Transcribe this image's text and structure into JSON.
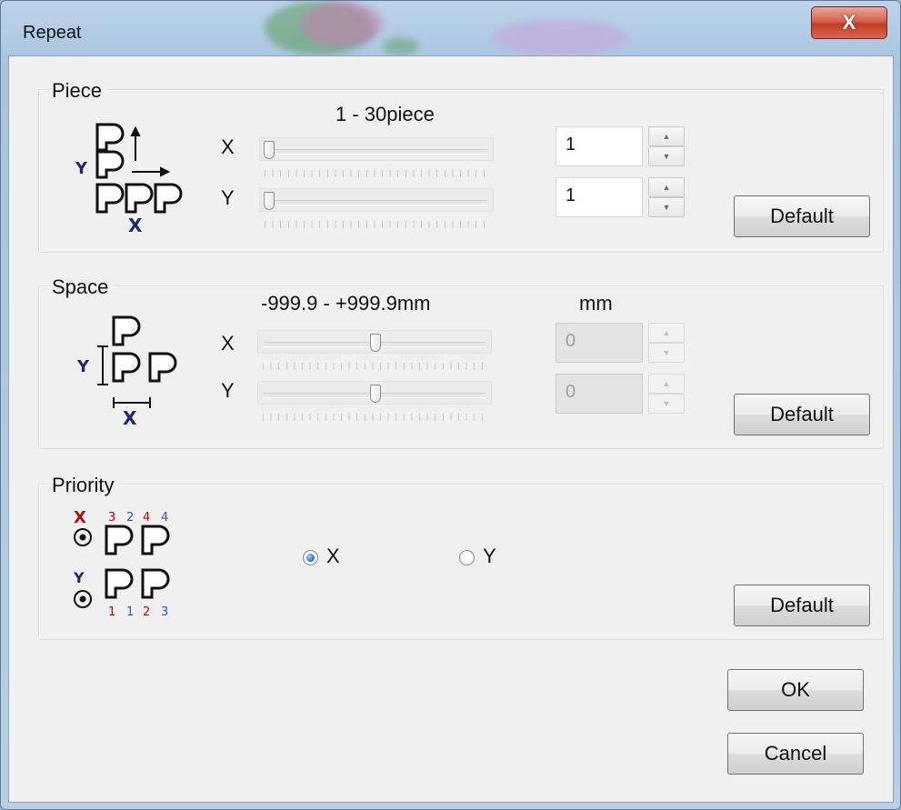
{
  "window": {
    "title": "Repeat",
    "close_label": "X"
  },
  "piece": {
    "title": "Piece",
    "range_label": "1 - 30piece",
    "x_label": "X",
    "y_label": "Y",
    "x_value": "1",
    "y_value": "1",
    "x_slider_position": 1,
    "y_slider_position": 1,
    "slider_min": 1,
    "slider_max": 30,
    "default_label": "Default",
    "icon": {
      "y_label": "Y",
      "x_label": "X"
    }
  },
  "space": {
    "title": "Space",
    "range_label": "-999.9 - +999.9mm",
    "unit_label": "mm",
    "x_label": "X",
    "y_label": "Y",
    "x_value": "0",
    "y_value": "0",
    "x_slider_position": 0,
    "y_slider_position": 0,
    "slider_min": -999.9,
    "slider_max": 999.9,
    "default_label": "Default",
    "icon": {
      "y_label": "Y",
      "x_label": "X"
    }
  },
  "priority": {
    "title": "Priority",
    "option_x": "X",
    "option_y": "Y",
    "selected": "X",
    "default_label": "Default",
    "icon": {
      "x_mark": "X",
      "y_mark": "Y",
      "top_numbers": [
        "3",
        "2",
        "4",
        "4"
      ],
      "bottom_numbers": [
        "1",
        "1",
        "2",
        "3"
      ]
    }
  },
  "footer": {
    "ok_label": "OK",
    "cancel_label": "Cancel"
  },
  "colors": {
    "red_number": "#cc0000",
    "blue_number": "#3355aa",
    "icon_dark_blue": "#1c2a6b"
  }
}
